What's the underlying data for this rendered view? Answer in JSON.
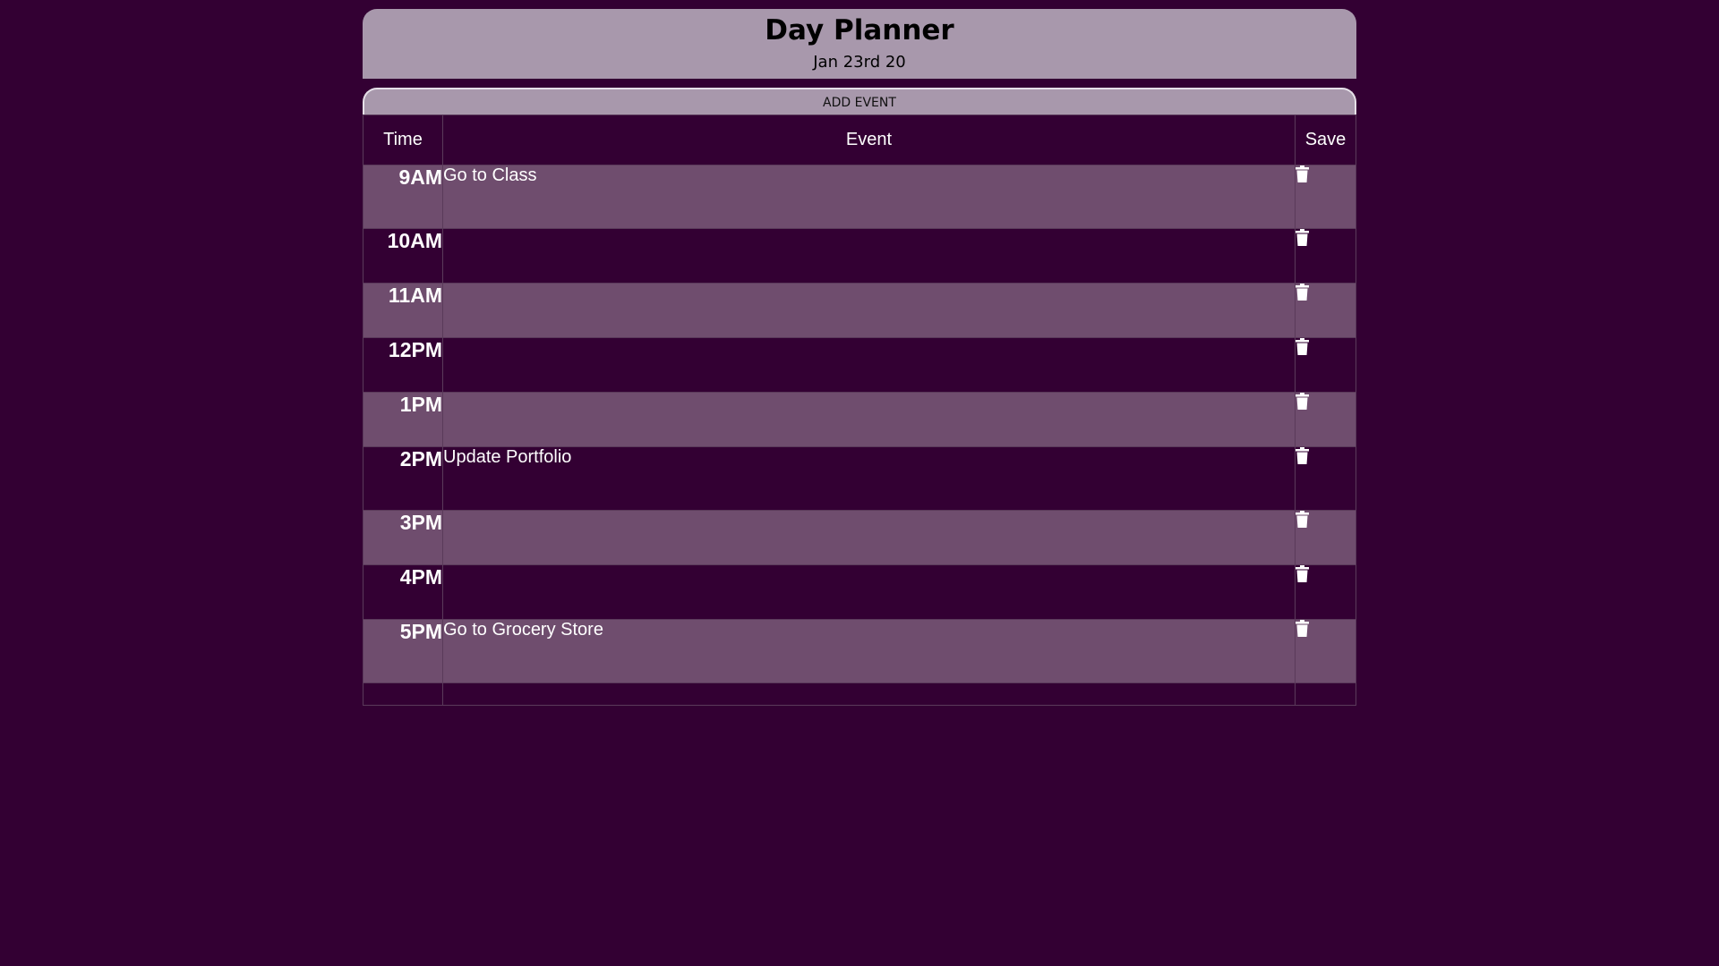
{
  "header": {
    "title": "Day Planner",
    "date": "Jan 23rd 20"
  },
  "add_event_label": "ADD EVENT",
  "table": {
    "columns": [
      "Time",
      "Event",
      "Save"
    ],
    "rows": [
      {
        "time": "9AM",
        "event": "Go to Class",
        "save_icon": "trash-icon"
      },
      {
        "time": "10AM",
        "event": "",
        "save_icon": "trash-icon"
      },
      {
        "time": "11AM",
        "event": "",
        "save_icon": "trash-icon"
      },
      {
        "time": "12PM",
        "event": "",
        "save_icon": "trash-icon"
      },
      {
        "time": "1PM",
        "event": "",
        "save_icon": "trash-icon"
      },
      {
        "time": "2PM",
        "event": "Update Portfolio",
        "save_icon": "trash-icon"
      },
      {
        "time": "3PM",
        "event": "",
        "save_icon": "trash-icon"
      },
      {
        "time": "4PM",
        "event": "",
        "save_icon": "trash-icon"
      },
      {
        "time": "5PM",
        "event": "Go to Grocery Store",
        "save_icon": "trash-icon"
      }
    ]
  },
  "colors": {
    "background": "#330033",
    "header": "#a898ac",
    "row_light": "#6f4d6e",
    "row_dark": "#330033"
  }
}
